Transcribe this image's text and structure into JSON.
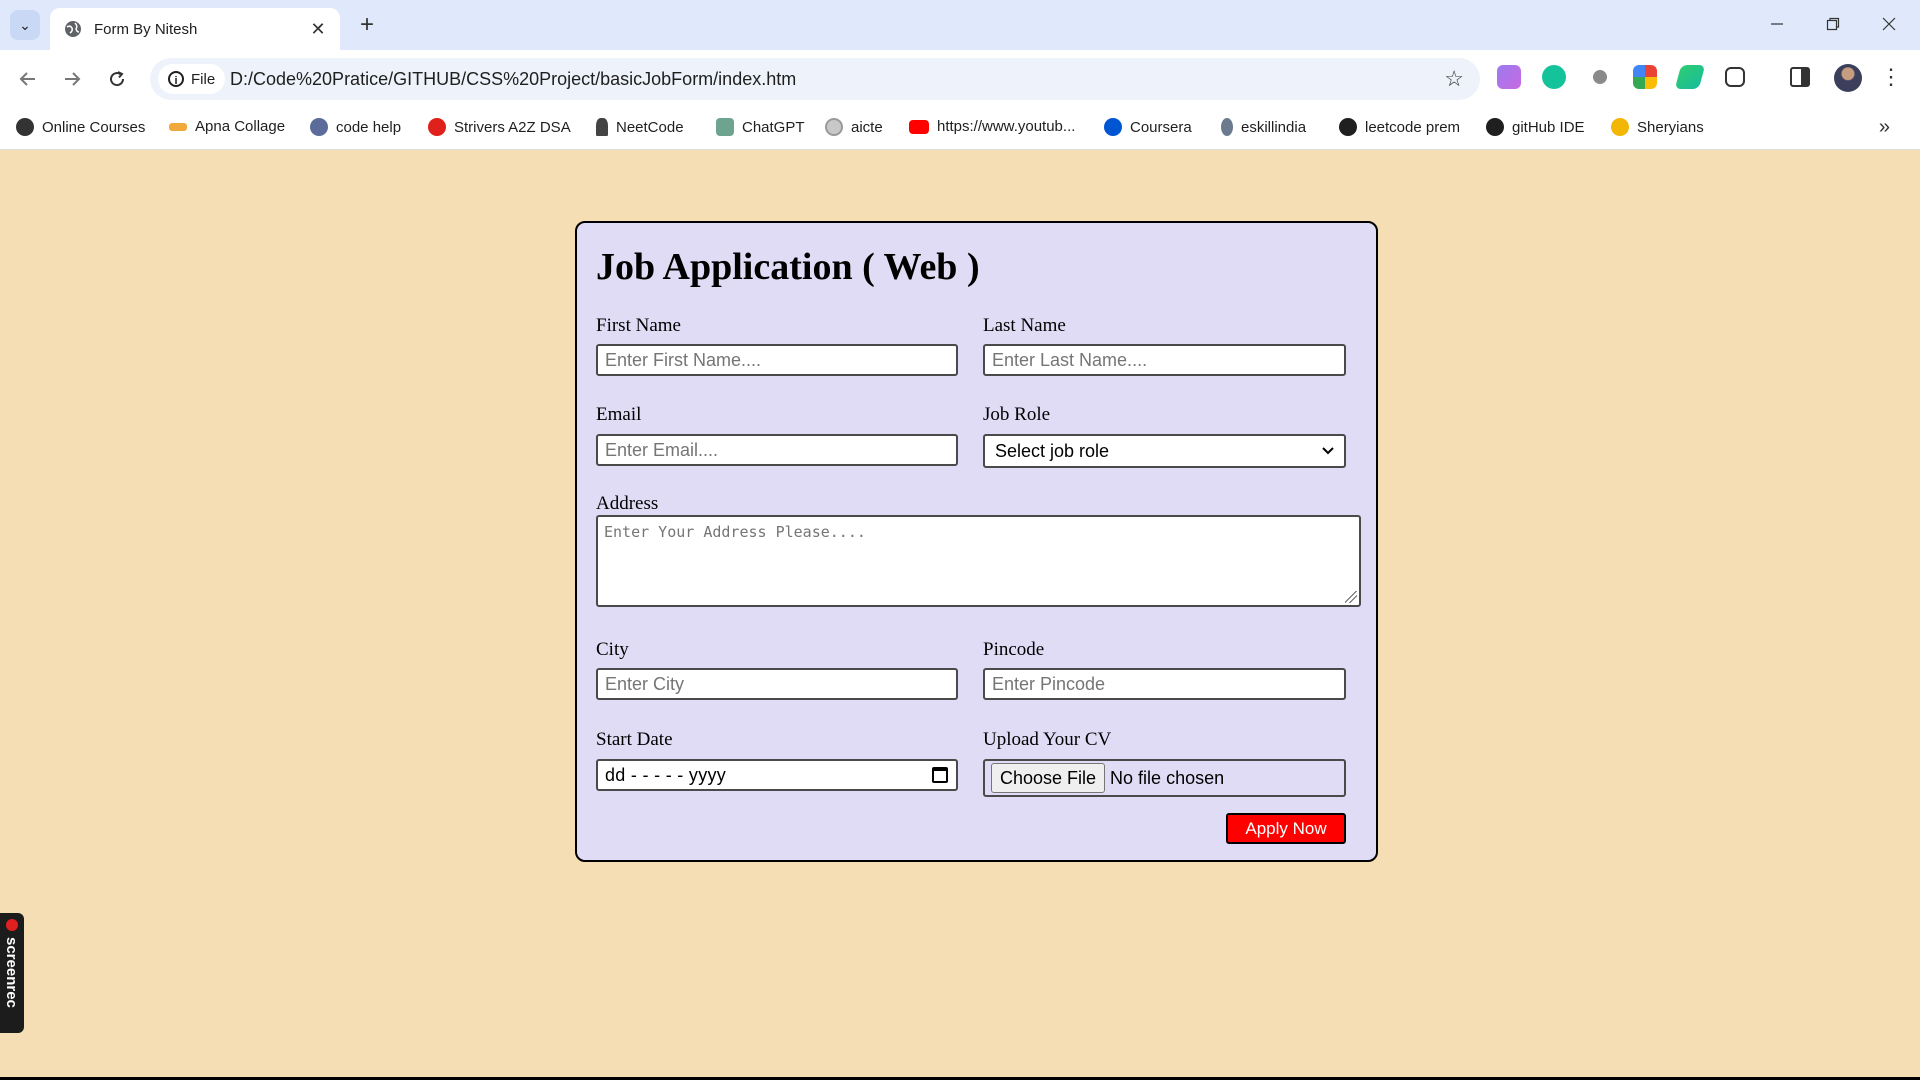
{
  "browser": {
    "tab": {
      "title": "Form By Nitesh",
      "close_glyph": "✕"
    },
    "new_tab_glyph": "+",
    "address": {
      "scheme_label": "File",
      "url": "D:/Code%20Pratice/GITHUB/CSS%20Project/basicJobForm/index.htm"
    },
    "bookmarks": [
      {
        "label": "Online Courses",
        "icon": "codewithharry-icon",
        "color": "#333333"
      },
      {
        "label": "Apna Collage",
        "icon": "apna-college-icon",
        "color": "#f2a93b"
      },
      {
        "label": "code help",
        "icon": "code-help-icon",
        "color": "#5b6b9a"
      },
      {
        "label": "Strivers A2Z DSA",
        "icon": "takeuforward-icon",
        "color": "#e0201b"
      },
      {
        "label": "NeetCode",
        "icon": "neetcode-icon",
        "color": "#444444"
      },
      {
        "label": "ChatGPT",
        "icon": "chatgpt-icon",
        "color": "#6ea38f"
      },
      {
        "label": "aicte",
        "icon": "aicte-icon",
        "color": "#9a9a9a"
      },
      {
        "label": "https://www.youtub...",
        "icon": "youtube-icon",
        "color": "#ff0000"
      },
      {
        "label": "Coursera",
        "icon": "coursera-icon",
        "color": "#0056d2"
      },
      {
        "label": "eskillindia",
        "icon": "eskillindia-icon",
        "color": "#6b7a8f"
      },
      {
        "label": "leetcode prem",
        "icon": "github-icon",
        "color": "#1f1f1f"
      },
      {
        "label": "gitHub IDE",
        "icon": "github-icon",
        "color": "#1f1f1f"
      },
      {
        "label": "Sheryians",
        "icon": "sheryians-icon",
        "color": "#f2b705"
      }
    ],
    "more_bookmarks_glyph": "»"
  },
  "form": {
    "title": "Job Application ( Web )",
    "first_name": {
      "label": "First Name",
      "placeholder": "Enter First Name...."
    },
    "last_name": {
      "label": "Last Name",
      "placeholder": "Enter Last Name...."
    },
    "email": {
      "label": "Email",
      "placeholder": "Enter Email...."
    },
    "job_role": {
      "label": "Job Role",
      "selected": "Select job role"
    },
    "address": {
      "label": "Address",
      "placeholder": "Enter Your Address Please...."
    },
    "city": {
      "label": "City",
      "placeholder": "Enter City"
    },
    "pincode": {
      "label": "Pincode",
      "placeholder": "Enter Pincode"
    },
    "start_date": {
      "label": "Start Date",
      "value": "dd - - - - - yyyy"
    },
    "cv": {
      "label": "Upload Your CV",
      "button": "Choose File",
      "status": "No file chosen"
    },
    "submit": "Apply Now"
  },
  "overlay": {
    "recorder": "screenrec"
  },
  "colors": {
    "page_bg": "#f5deb3",
    "card_bg": "#e0dcf5",
    "submit_bg": "#ff0000",
    "chrome_tabstrip": "#dfe9fb"
  }
}
